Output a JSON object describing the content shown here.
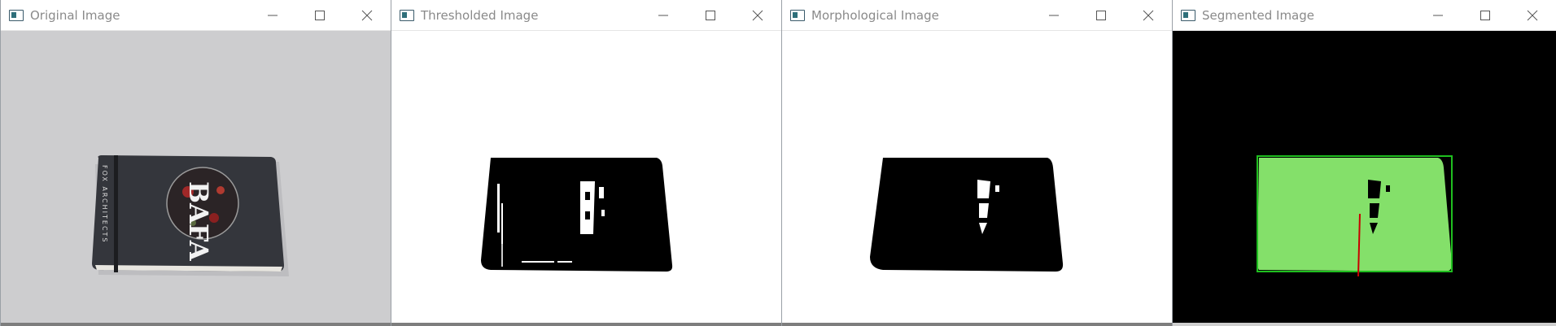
{
  "windows": [
    {
      "title": "Original Image"
    },
    {
      "title": "Thresholded Image"
    },
    {
      "title": "Morphological Image"
    },
    {
      "title": "Segmented Image"
    }
  ],
  "book": {
    "spine_text": "FOX ARCHITECTS",
    "cover_text": "BAFA"
  },
  "colors": {
    "original_background": "#cdcdcf",
    "book_cover": "#34363c",
    "segment_fill": "#84e06a",
    "segment_box": "#1fbf1f",
    "axis_line": "#c80000",
    "segmented_background": "#000000"
  },
  "icons": {
    "minimize": "minimize-icon",
    "maximize": "maximize-icon",
    "close": "close-icon"
  }
}
